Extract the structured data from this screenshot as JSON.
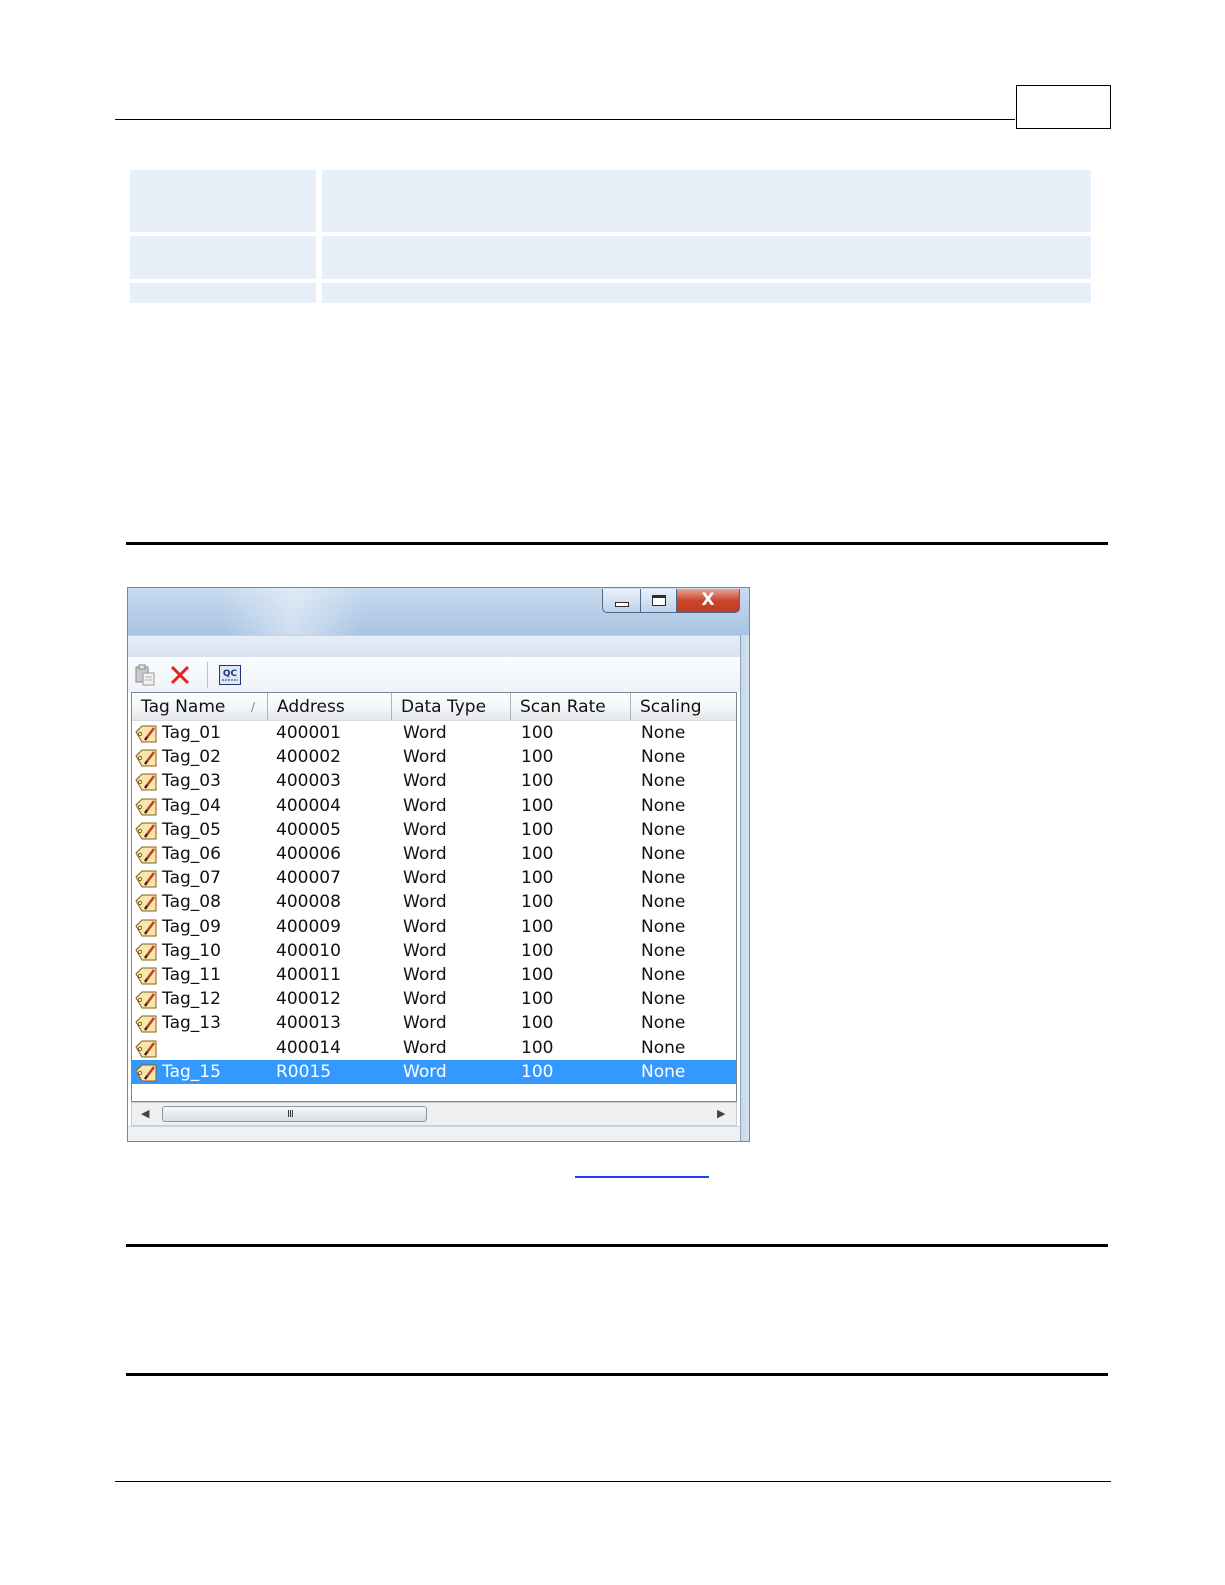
{
  "window": {
    "columns": [
      "Tag Name",
      "Address",
      "Data Type",
      "Scan Rate",
      "Scaling"
    ],
    "rows": [
      {
        "name": "Tag_01",
        "address": "400001",
        "type": "Word",
        "rate": "100",
        "scaling": "None"
      },
      {
        "name": "Tag_02",
        "address": "400002",
        "type": "Word",
        "rate": "100",
        "scaling": "None"
      },
      {
        "name": "Tag_03",
        "address": "400003",
        "type": "Word",
        "rate": "100",
        "scaling": "None"
      },
      {
        "name": "Tag_04",
        "address": "400004",
        "type": "Word",
        "rate": "100",
        "scaling": "None"
      },
      {
        "name": "Tag_05",
        "address": "400005",
        "type": "Word",
        "rate": "100",
        "scaling": "None"
      },
      {
        "name": "Tag_06",
        "address": "400006",
        "type": "Word",
        "rate": "100",
        "scaling": "None"
      },
      {
        "name": "Tag_07",
        "address": "400007",
        "type": "Word",
        "rate": "100",
        "scaling": "None"
      },
      {
        "name": "Tag_08",
        "address": "400008",
        "type": "Word",
        "rate": "100",
        "scaling": "None"
      },
      {
        "name": "Tag_09",
        "address": "400009",
        "type": "Word",
        "rate": "100",
        "scaling": "None"
      },
      {
        "name": "Tag_10",
        "address": "400010",
        "type": "Word",
        "rate": "100",
        "scaling": "None"
      },
      {
        "name": "Tag_11",
        "address": "400011",
        "type": "Word",
        "rate": "100",
        "scaling": "None"
      },
      {
        "name": "Tag_12",
        "address": "400012",
        "type": "Word",
        "rate": "100",
        "scaling": "None"
      },
      {
        "name": "Tag_13",
        "address": "400013",
        "type": "Word",
        "rate": "100",
        "scaling": "None"
      },
      {
        "name": "",
        "address": "400014",
        "type": "Word",
        "rate": "100",
        "scaling": "None"
      },
      {
        "name": "Tag_15",
        "address": "R0015",
        "type": "Word",
        "rate": "100",
        "scaling": "None",
        "selected": true
      }
    ],
    "scrollbar_grip": "III",
    "toolbar": {
      "paste_icon": "paste-icon",
      "delete_icon": "delete-x-icon",
      "qc_icon": "qc-icon",
      "qc_label": "QC"
    },
    "close_glyph": "X",
    "sort_glyph": "/"
  },
  "colors": {
    "table_fill": "#e7eff8",
    "selection": "#3399ff",
    "link": "#1f3fff",
    "delete_icon": "#e0241b"
  }
}
